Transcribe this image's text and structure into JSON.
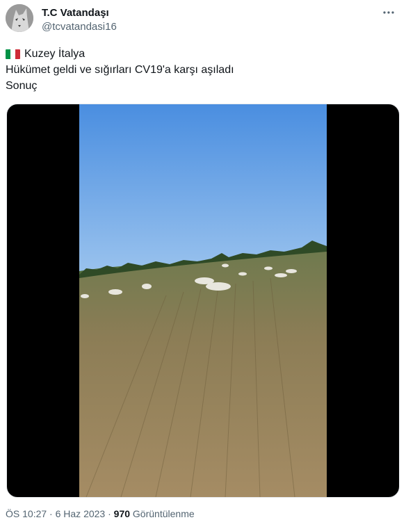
{
  "author": {
    "name": "T.C Vatandaşı",
    "handle": "@tcvatandasi16",
    "avatar_icon": "wolf-avatar-icon"
  },
  "tweet": {
    "flag_icon": "italy-flag-icon",
    "lines": [
      "Kuzey İtalya",
      "Hükümet geldi ve sığırları CV19'a karşı aşıladı",
      "Sonuç"
    ]
  },
  "media": {
    "type": "video",
    "description_icon": "video-frame"
  },
  "footer": {
    "time": "ÖS 10:27",
    "separator": "·",
    "date": "6 Haz 2023",
    "views_count": "970",
    "views_label": "Görüntülenme"
  },
  "colors": {
    "text_primary": "#0f1419",
    "text_secondary": "#536471",
    "border": "#e6e9ec"
  }
}
